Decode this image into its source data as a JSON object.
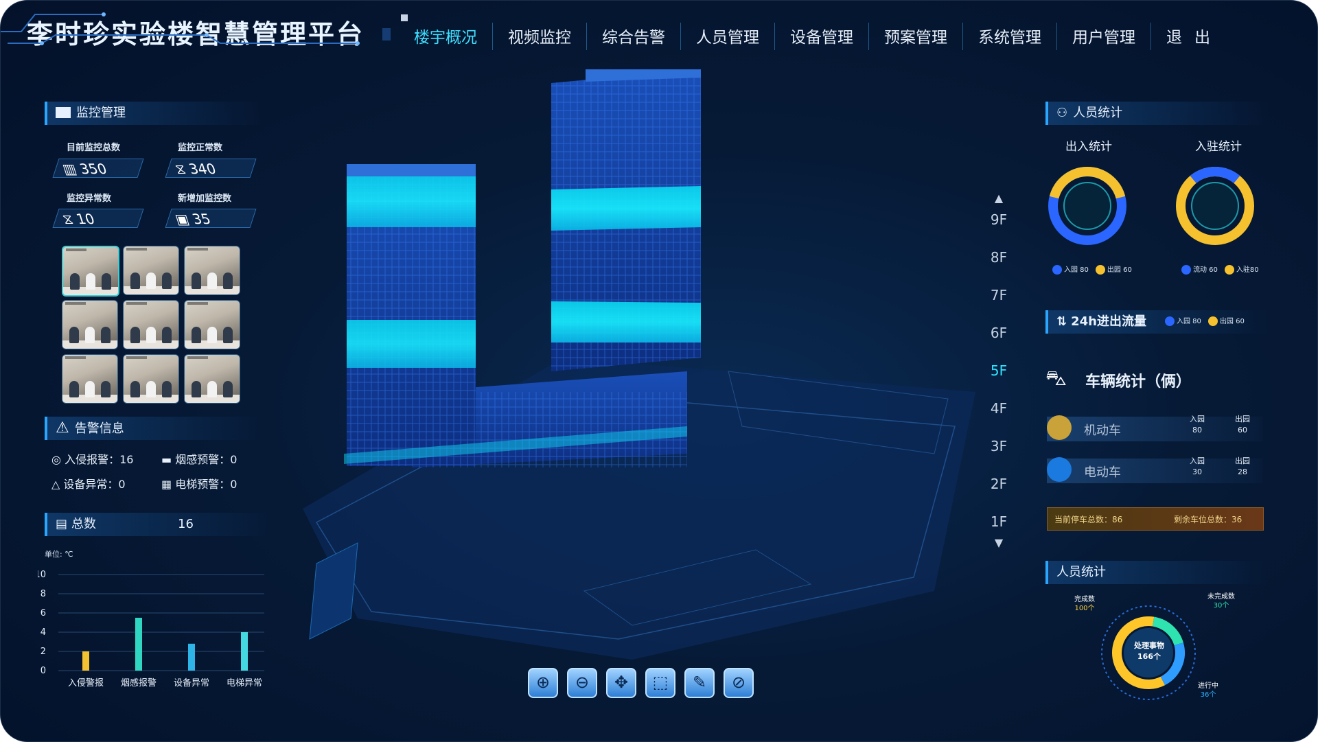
{
  "app": {
    "title": "李时珍实验楼智慧管理平台"
  },
  "nav": [
    {
      "label": "楼宇概况",
      "active": true
    },
    {
      "label": "视频监控"
    },
    {
      "label": "综合告警"
    },
    {
      "label": "人员管理"
    },
    {
      "label": "设备管理"
    },
    {
      "label": "预案管理"
    },
    {
      "label": "系统管理"
    },
    {
      "label": "用户管理"
    },
    {
      "label": "退出"
    }
  ],
  "monitor": {
    "heading": "监控管理",
    "total_label": "目前监控总数",
    "total": "350",
    "normal_label": "监控正常数",
    "normal": "340",
    "abnormal_label": "监控异常数",
    "abnormal": "10",
    "new_label": "新增加监控数",
    "new": "35"
  },
  "alarm": {
    "heading": "告警信息",
    "intrusion": "入侵报警：16",
    "smoke": "烟感预警：0",
    "device": "设备异常：0",
    "elevator": "电梯预警：0"
  },
  "total": {
    "label": "总数",
    "value": "16"
  },
  "chart_data": {
    "type": "bar",
    "unit_label": "单位: ℃",
    "categories": [
      "入侵警报",
      "烟感报警",
      "设备异常",
      "电梯异常"
    ],
    "values": [
      2,
      5.5,
      2.8,
      4
    ],
    "colors": [
      "#f2c230",
      "#2fd7c2",
      "#2fb4e8",
      "#44d8e0"
    ],
    "ylim": [
      0,
      10
    ],
    "yticks": [
      0,
      2,
      4,
      6,
      8,
      10
    ]
  },
  "floors": {
    "up_arrow": "▲",
    "down_arrow": "▼",
    "list": [
      "9F",
      "8F",
      "7F",
      "6F",
      "5F",
      "4F",
      "3F",
      "2F",
      "1F"
    ],
    "active": "5F"
  },
  "people": {
    "heading": "人员统计",
    "inout_title": "出入统计",
    "resident_title": "入驻统计",
    "inout_legend": [
      {
        "label": "入园 80",
        "color": "#2a66ff"
      },
      {
        "label": "出园 60",
        "color": "#f5c12e"
      }
    ],
    "resident_legend": [
      {
        "label": "流动 60",
        "color": "#2a66ff"
      },
      {
        "label": "入驻80",
        "color": "#f5c12e"
      }
    ],
    "inout_share": 0.42,
    "resident_share": 0.22
  },
  "flow": {
    "title": "24h进出流量",
    "legend": [
      {
        "label": "入园 80",
        "color": "#2a66ff"
      },
      {
        "label": "出园 60",
        "color": "#f5c12e"
      }
    ]
  },
  "vehicle": {
    "title": "车辆统计（俩）",
    "rows": [
      {
        "name": "机动车",
        "in_label": "入园",
        "in": "80",
        "out_label": "出园",
        "out": "60"
      },
      {
        "name": "电动车",
        "in_label": "入园",
        "in": "30",
        "out_label": "出园",
        "out": "28"
      }
    ],
    "parking_now": "当前停车总数：86",
    "parking_left": "剩余车位总数：36"
  },
  "staff": {
    "heading": "人员统计",
    "center_title": "处理事物",
    "center_value": "166个",
    "done_label": "完成数",
    "done_value": "100个",
    "undone_label": "未完成数",
    "undone_value": "30个",
    "doing_label": "进行中",
    "doing_value": "36个",
    "shares": [
      0.6,
      0.18,
      0.22
    ]
  },
  "tools": [
    {
      "name": "zoom-in-icon",
      "glyph": "⊕"
    },
    {
      "name": "zoom-out-icon",
      "glyph": "⊖"
    },
    {
      "name": "move-icon",
      "glyph": "✥"
    },
    {
      "name": "select-icon",
      "glyph": "⬚"
    },
    {
      "name": "measure-icon",
      "glyph": "✎"
    },
    {
      "name": "reset-icon",
      "glyph": "⊘"
    }
  ]
}
